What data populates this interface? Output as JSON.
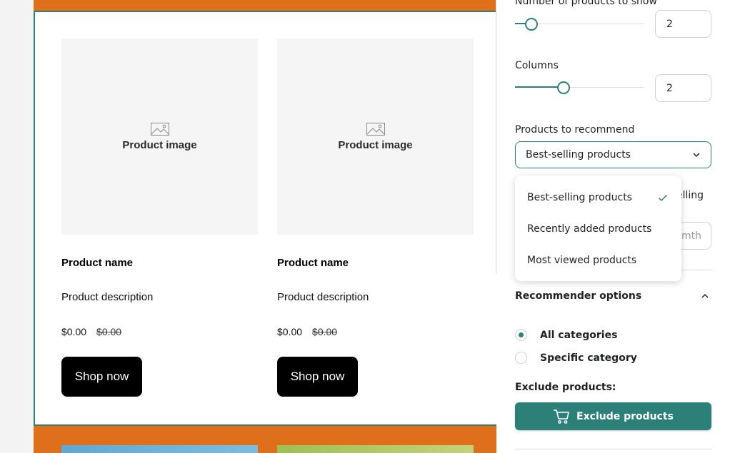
{
  "preview": {
    "products": [
      {
        "image_label": "Product image",
        "name": "Product name",
        "description": "Product description",
        "price": "$0.00",
        "old_price": "$0.00",
        "button_label": "Shop now"
      },
      {
        "image_label": "Product image",
        "name": "Product name",
        "description": "Product description",
        "price": "$0.00",
        "old_price": "$0.00",
        "button_label": "Shop now"
      }
    ]
  },
  "settings": {
    "products_count": {
      "label": "Number of products to show",
      "value": "2",
      "slider_fraction": 0.13
    },
    "columns": {
      "label": "Columns",
      "value": "2",
      "slider_fraction": 0.38
    },
    "recommend": {
      "label": "Products to recommend",
      "selected": "Best-selling products"
    },
    "partially_hidden_label_fragment": "elling",
    "partially_hidden_field_fragment": "mth",
    "recommender_options": {
      "title": "Recommender options",
      "radio": [
        {
          "label": "All categories",
          "selected": true
        },
        {
          "label": "Specific category",
          "selected": false
        }
      ]
    },
    "exclude": {
      "label": "Exclude products:",
      "button_label": "Exclude products"
    }
  },
  "dropdown": {
    "options": [
      {
        "label": "Best-selling products",
        "checked": true
      },
      {
        "label": "Recently added products",
        "checked": false
      },
      {
        "label": "Most viewed products",
        "checked": false
      }
    ]
  },
  "colors": {
    "accent": "#2d8078",
    "canvas_background": "#df6f1a",
    "button_dark": "#000000"
  },
  "icons": [
    "image-placeholder-icon",
    "chevron-down-icon",
    "chevron-up-icon",
    "check-icon",
    "cart-icon"
  ]
}
